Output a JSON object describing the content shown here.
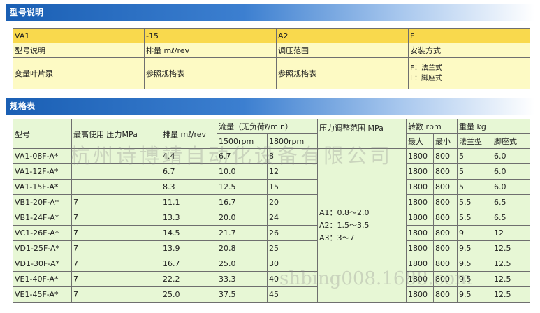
{
  "sections": {
    "model_title": "型号说明",
    "spec_title": "规格表"
  },
  "model_table": {
    "codes": [
      "VA1",
      "-15",
      "A2",
      "F"
    ],
    "labels": [
      "型号说明",
      "排量 mℓ/rev",
      "调压范围",
      "安装方式"
    ],
    "desc": [
      "变量叶片泵",
      "参照规格表",
      "参照规格表"
    ],
    "mount": [
      "F：法兰式",
      "L：脚座式"
    ]
  },
  "spec_table": {
    "headers": {
      "model": "型号",
      "max_pressure": "最高使用 压力MPa",
      "displacement": "排量 mℓ/rev",
      "flow": "流量（无负荷ℓ/min）",
      "flow_1500": "1500rpm",
      "flow_1800": "1800rpm",
      "pressure_range": "压力调整范围 MPa",
      "speed": "转数 rpm",
      "speed_max": "最大",
      "speed_min": "最小",
      "weight": "重量 kg",
      "weight_flange": "法兰型",
      "weight_foot": "脚座式"
    },
    "pressure_ranges": [
      "A1：0.8～2.0",
      "A2：1.5～3.5",
      "A3：3～7"
    ],
    "rows": [
      {
        "model": "VA1-08F-A*",
        "max_p": "",
        "disp": "4.4",
        "f1500": "6.7",
        "f1800": "8",
        "max_rpm": "1800",
        "min_rpm": "800",
        "flange": "5",
        "foot": "6.0"
      },
      {
        "model": "VA1-12F-A*",
        "max_p": "",
        "disp": "6.7",
        "f1500": "10.0",
        "f1800": "12",
        "max_rpm": "1800",
        "min_rpm": "800",
        "flange": "5",
        "foot": "6.0"
      },
      {
        "model": "VA1-15F-A*",
        "max_p": "",
        "disp": "8.3",
        "f1500": "12.5",
        "f1800": "15",
        "max_rpm": "1800",
        "min_rpm": "800",
        "flange": "5",
        "foot": "6.0"
      },
      {
        "model": "VB1-20F-A*",
        "max_p": "7",
        "disp": "11.1",
        "f1500": "16.7",
        "f1800": "20",
        "max_rpm": "1800",
        "min_rpm": "800",
        "flange": "5.5",
        "foot": "6.5"
      },
      {
        "model": "VB1-24F-A*",
        "max_p": "7",
        "disp": "13.3",
        "f1500": "20.0",
        "f1800": "24",
        "max_rpm": "1800",
        "min_rpm": "800",
        "flange": "5.5",
        "foot": "6.5"
      },
      {
        "model": "VC1-26F-A*",
        "max_p": "7",
        "disp": "14.5",
        "f1500": "21.7",
        "f1800": "26",
        "max_rpm": "1800",
        "min_rpm": "800",
        "flange": "9",
        "foot": "12"
      },
      {
        "model": "VD1-25F-A*",
        "max_p": "7",
        "disp": "13.9",
        "f1500": "20.8",
        "f1800": "25",
        "max_rpm": "1800",
        "min_rpm": "800",
        "flange": "9.5",
        "foot": "12.5"
      },
      {
        "model": "VD1-30F-A*",
        "max_p": "7",
        "disp": "16.7",
        "f1500": "25.0",
        "f1800": "30",
        "max_rpm": "1800",
        "min_rpm": "800",
        "flange": "9.5",
        "foot": "12.5"
      },
      {
        "model": "VE1-40F-A*",
        "max_p": "7",
        "disp": "22.2",
        "f1500": "33.3",
        "f1800": "40",
        "max_rpm": "1800",
        "min_rpm": "800",
        "flange": "9.5",
        "foot": "12.5"
      },
      {
        "model": "VE1-45F-A*",
        "max_p": "7",
        "disp": "25.0",
        "f1500": "37.5",
        "f1800": "45",
        "max_rpm": "1800",
        "min_rpm": "800",
        "flange": "9.5",
        "foot": "12.5"
      }
    ]
  },
  "watermarks": [
    "杭州诗博靖自动化设备有限公司",
    "shbing008.1688.com"
  ]
}
